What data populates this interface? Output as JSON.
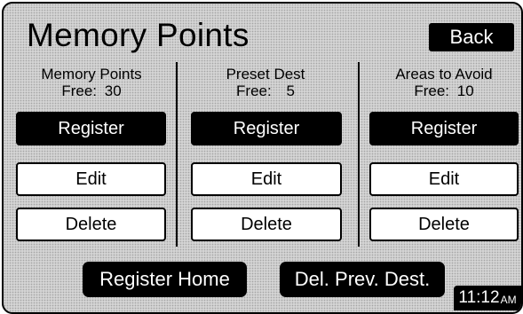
{
  "screen": {
    "title": "Memory Points",
    "back_label": "Back"
  },
  "columns": [
    {
      "heading": "Memory Points",
      "free_label": "Free:",
      "free_count": "30",
      "register_label": "Register",
      "edit_label": "Edit",
      "delete_label": "Delete"
    },
    {
      "heading": "Preset Dest",
      "free_label": "Free:",
      "free_count": "5",
      "register_label": "Register",
      "edit_label": "Edit",
      "delete_label": "Delete"
    },
    {
      "heading": "Areas to Avoid",
      "free_label": "Free:",
      "free_count": "10",
      "register_label": "Register",
      "edit_label": "Edit",
      "delete_label": "Delete"
    }
  ],
  "footer": {
    "register_home_label": "Register Home",
    "del_prev_dest_label": "Del. Prev. Dest."
  },
  "clock": {
    "time": "11:12",
    "ampm": "AM"
  },
  "colors": {
    "background": "#d4d4d4",
    "button_dark": "#000000",
    "button_light": "#ffffff"
  }
}
